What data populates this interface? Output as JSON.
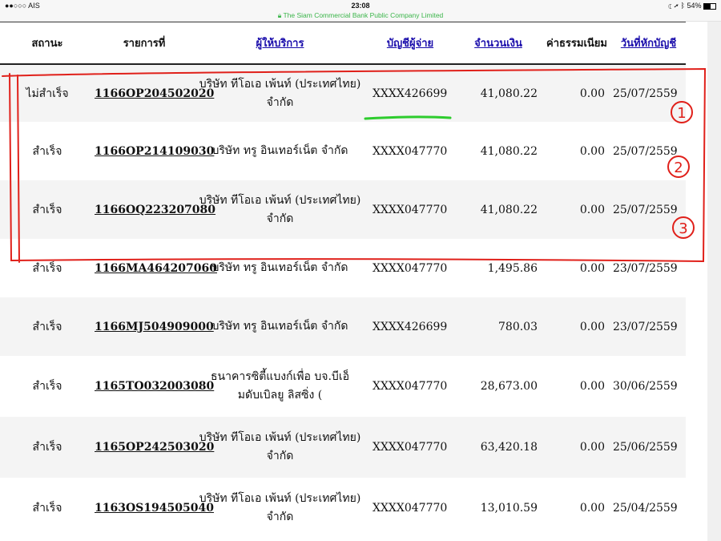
{
  "status_bar": {
    "carrier": "●●○○○ AIS",
    "time": "23:08",
    "url": "The Siam Commercial Bank Public Company Limited",
    "battery": "54%"
  },
  "table": {
    "headers": {
      "status": "สถานะ",
      "reference": "รายการที่",
      "provider": "ผู้ให้บริการ",
      "account": "บัญชีผู้จ่าย",
      "amount": "จำนวนเงิน",
      "fee": "ค่าธรรมเนียม",
      "date": "วันที่หักบัญชี"
    },
    "rows": [
      {
        "status": "ไม่สำเร็จ",
        "reference": "1166OP204502020",
        "provider_line1": "บริษัท ทีโอเอ เพ้นท์ (ประเทศไทย)",
        "provider_line2": "จำกัด",
        "account": "XXXX426699",
        "amount": "41,080.22",
        "fee": "0.00",
        "date": "25/07/2559"
      },
      {
        "status": "สำเร็จ",
        "reference": "1166OP214109030",
        "provider_line1": "บริษัท ทรู อินเทอร์เน็ต จำกัด",
        "provider_line2": "",
        "account": "XXXX047770",
        "amount": "41,080.22",
        "fee": "0.00",
        "date": "25/07/2559"
      },
      {
        "status": "สำเร็จ",
        "reference": "1166OQ223207080",
        "provider_line1": "บริษัท ทีโอเอ เพ้นท์ (ประเทศไทย)",
        "provider_line2": "จำกัด",
        "account": "XXXX047770",
        "amount": "41,080.22",
        "fee": "0.00",
        "date": "25/07/2559"
      },
      {
        "status": "สำเร็จ",
        "reference": "1166MA464207060",
        "provider_line1": "บริษัท ทรู อินเทอร์เน็ต จำกัด",
        "provider_line2": "",
        "account": "XXXX047770",
        "amount": "1,495.86",
        "fee": "0.00",
        "date": "23/07/2559"
      },
      {
        "status": "สำเร็จ",
        "reference": "1166MJ504909000",
        "provider_line1": "บริษัท ทรู อินเทอร์เน็ต จำกัด",
        "provider_line2": "",
        "account": "XXXX426699",
        "amount": "780.03",
        "fee": "0.00",
        "date": "23/07/2559"
      },
      {
        "status": "สำเร็จ",
        "reference": "1165TO032003080",
        "provider_line1": "ธนาคารซิตี้แบงก์เพื่อ บจ.บีเอ็",
        "provider_line2": "มดับเบิลยู ลิสซิ่ง (",
        "account": "XXXX047770",
        "amount": "28,673.00",
        "fee": "0.00",
        "date": "30/06/2559"
      },
      {
        "status": "สำเร็จ",
        "reference": "1165OP242503020",
        "provider_line1": "บริษัท ทีโอเอ เพ้นท์ (ประเทศไทย)",
        "provider_line2": "จำกัด",
        "account": "XXXX047770",
        "amount": "63,420.18",
        "fee": "0.00",
        "date": "25/06/2559"
      },
      {
        "status": "สำเร็จ",
        "reference": "1163OS194505040",
        "provider_line1": "บริษัท ทีโอเอ เพ้นท์ (ประเทศไทย)",
        "provider_line2": "จำกัด",
        "account": "XXXX047770",
        "amount": "13,010.59",
        "fee": "0.00",
        "date": "25/04/2559"
      }
    ]
  },
  "annotations": {
    "labels": [
      "1",
      "2",
      "3"
    ],
    "red_color": "#e0201a",
    "green_color": "#2dcc2d"
  }
}
